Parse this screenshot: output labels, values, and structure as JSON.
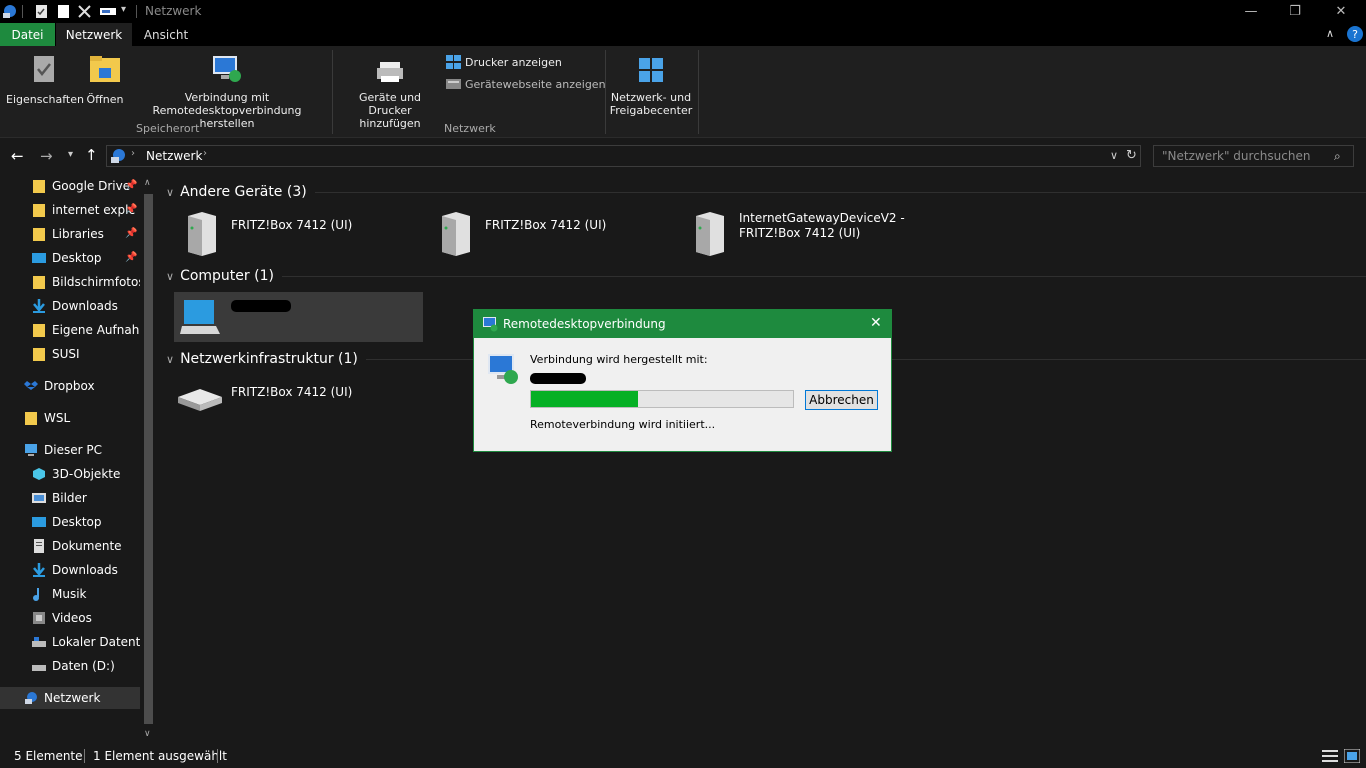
{
  "window": {
    "title": "Netzwerk"
  },
  "ribbon": {
    "tabs": [
      "Datei",
      "Netzwerk",
      "Ansicht"
    ],
    "properties_label": "Eigenschaften",
    "open_label": "Öffnen",
    "remote_desktop_label_1": "Verbindung mit",
    "remote_desktop_label_2": "Remotedesktopverbindung herstellen",
    "location_group": "Speicherort",
    "add_devices_label_1": "Geräte und Drucker",
    "add_devices_label_2": "hinzufügen",
    "show_printers_label": "Drucker anzeigen",
    "device_webpage_label": "Gerätewebseite anzeigen",
    "network_group": "Netzwerk",
    "network_center_label_1": "Netzwerk- und",
    "network_center_label_2": "Freigabecenter"
  },
  "address": {
    "path": "Netzwerk",
    "search_placeholder": "\"Netzwerk\" durchsuchen"
  },
  "nav": {
    "quick": [
      "Google Drive",
      "internet explc",
      "Libraries",
      "Desktop",
      "Bildschirmfotos",
      "Downloads",
      "Eigene Aufnahm",
      "SUSI"
    ],
    "dropbox": "Dropbox",
    "wsl": "WSL",
    "this_pc": "Dieser PC",
    "pc_items": [
      "3D-Objekte",
      "Bilder",
      "Desktop",
      "Dokumente",
      "Downloads",
      "Musik",
      "Videos",
      "Lokaler Datenträ",
      "Daten (D:)"
    ],
    "network": "Netzwerk"
  },
  "groups": {
    "other_devices": "Andere Geräte (3)",
    "computer": "Computer (1)",
    "infrastructure": "Netzwerkinfrastruktur (1)"
  },
  "devices": {
    "fritz1": "FRITZ!Box 7412 (UI)",
    "fritz2": "FRITZ!Box 7412 (UI)",
    "gateway_1": "InternetGatewayDeviceV2 -",
    "gateway_2": "FRITZ!Box 7412 (UI)",
    "infra_fritz": "FRITZ!Box 7412 (UI)"
  },
  "status": {
    "count": "5 Elemente",
    "selected": "1 Element ausgewählt"
  },
  "dialog": {
    "title": "Remotedesktopverbindung",
    "connecting": "Verbindung wird hergestellt mit:",
    "cancel": "Abbrechen",
    "status": "Remoteverbindung wird initiiert...",
    "progress": 0.41
  },
  "colors": {
    "accent": "#1e8a3e",
    "progress": "#06b025",
    "folder": "#f2c94c"
  }
}
